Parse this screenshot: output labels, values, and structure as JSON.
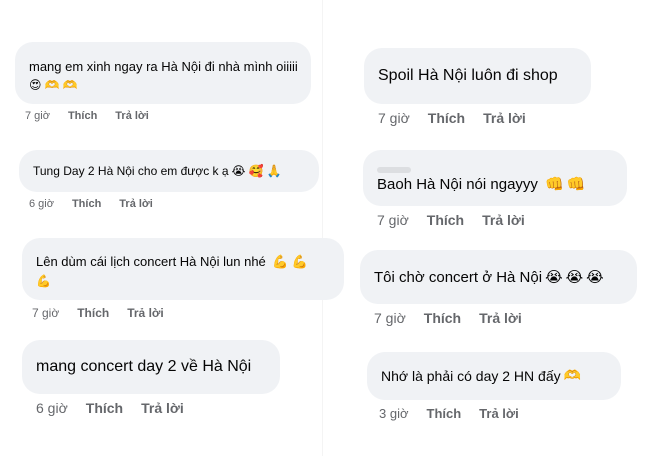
{
  "comments_left": [
    {
      "text": "mang em xinh ngay ra Hà Nội đi nhà mình oiiiii",
      "emojis": [
        "😍",
        "🫶",
        "🫶"
      ],
      "time": "7 giờ",
      "like": "Thích",
      "reply": "Trả lời"
    },
    {
      "text": "Tung Day 2 Hà Nội cho em được k ạ",
      "emojis": [
        "😭",
        "🥰",
        "🙏"
      ],
      "time": "6 giờ",
      "like": "Thích",
      "reply": "Trả lời"
    },
    {
      "text": "Lên dùm cái lịch concert Hà Nội lun nhé",
      "emojis": [
        "💪",
        "💪",
        "💪"
      ],
      "time": "7 giờ",
      "like": "Thích",
      "reply": "Trả lời"
    },
    {
      "text": "mang concert day 2 về Hà Nội",
      "emojis": [],
      "time": "6 giờ",
      "like": "Thích",
      "reply": "Trả lời"
    }
  ],
  "comments_right": [
    {
      "text": "Spoil Hà Nội luôn đi shop",
      "emojis": [],
      "time": "7 giờ",
      "like": "Thích",
      "reply": "Trả lời"
    },
    {
      "text": "Baoh Hà Nội nói ngayyy",
      "emojis": [
        "👊",
        "👊"
      ],
      "time": "7 giờ",
      "like": "Thích",
      "reply": "Trả lời"
    },
    {
      "text": "Tôi chờ concert ở Hà Nội",
      "emojis": [
        "😭",
        "😭",
        "😭"
      ],
      "time": "7 giờ",
      "like": "Thích",
      "reply": "Trả lời"
    },
    {
      "text": "Nhớ là phải có day 2 HN đấy",
      "emojis": [
        "🫶"
      ],
      "time": "3 giờ",
      "like": "Thích",
      "reply": "Trả lời"
    }
  ]
}
